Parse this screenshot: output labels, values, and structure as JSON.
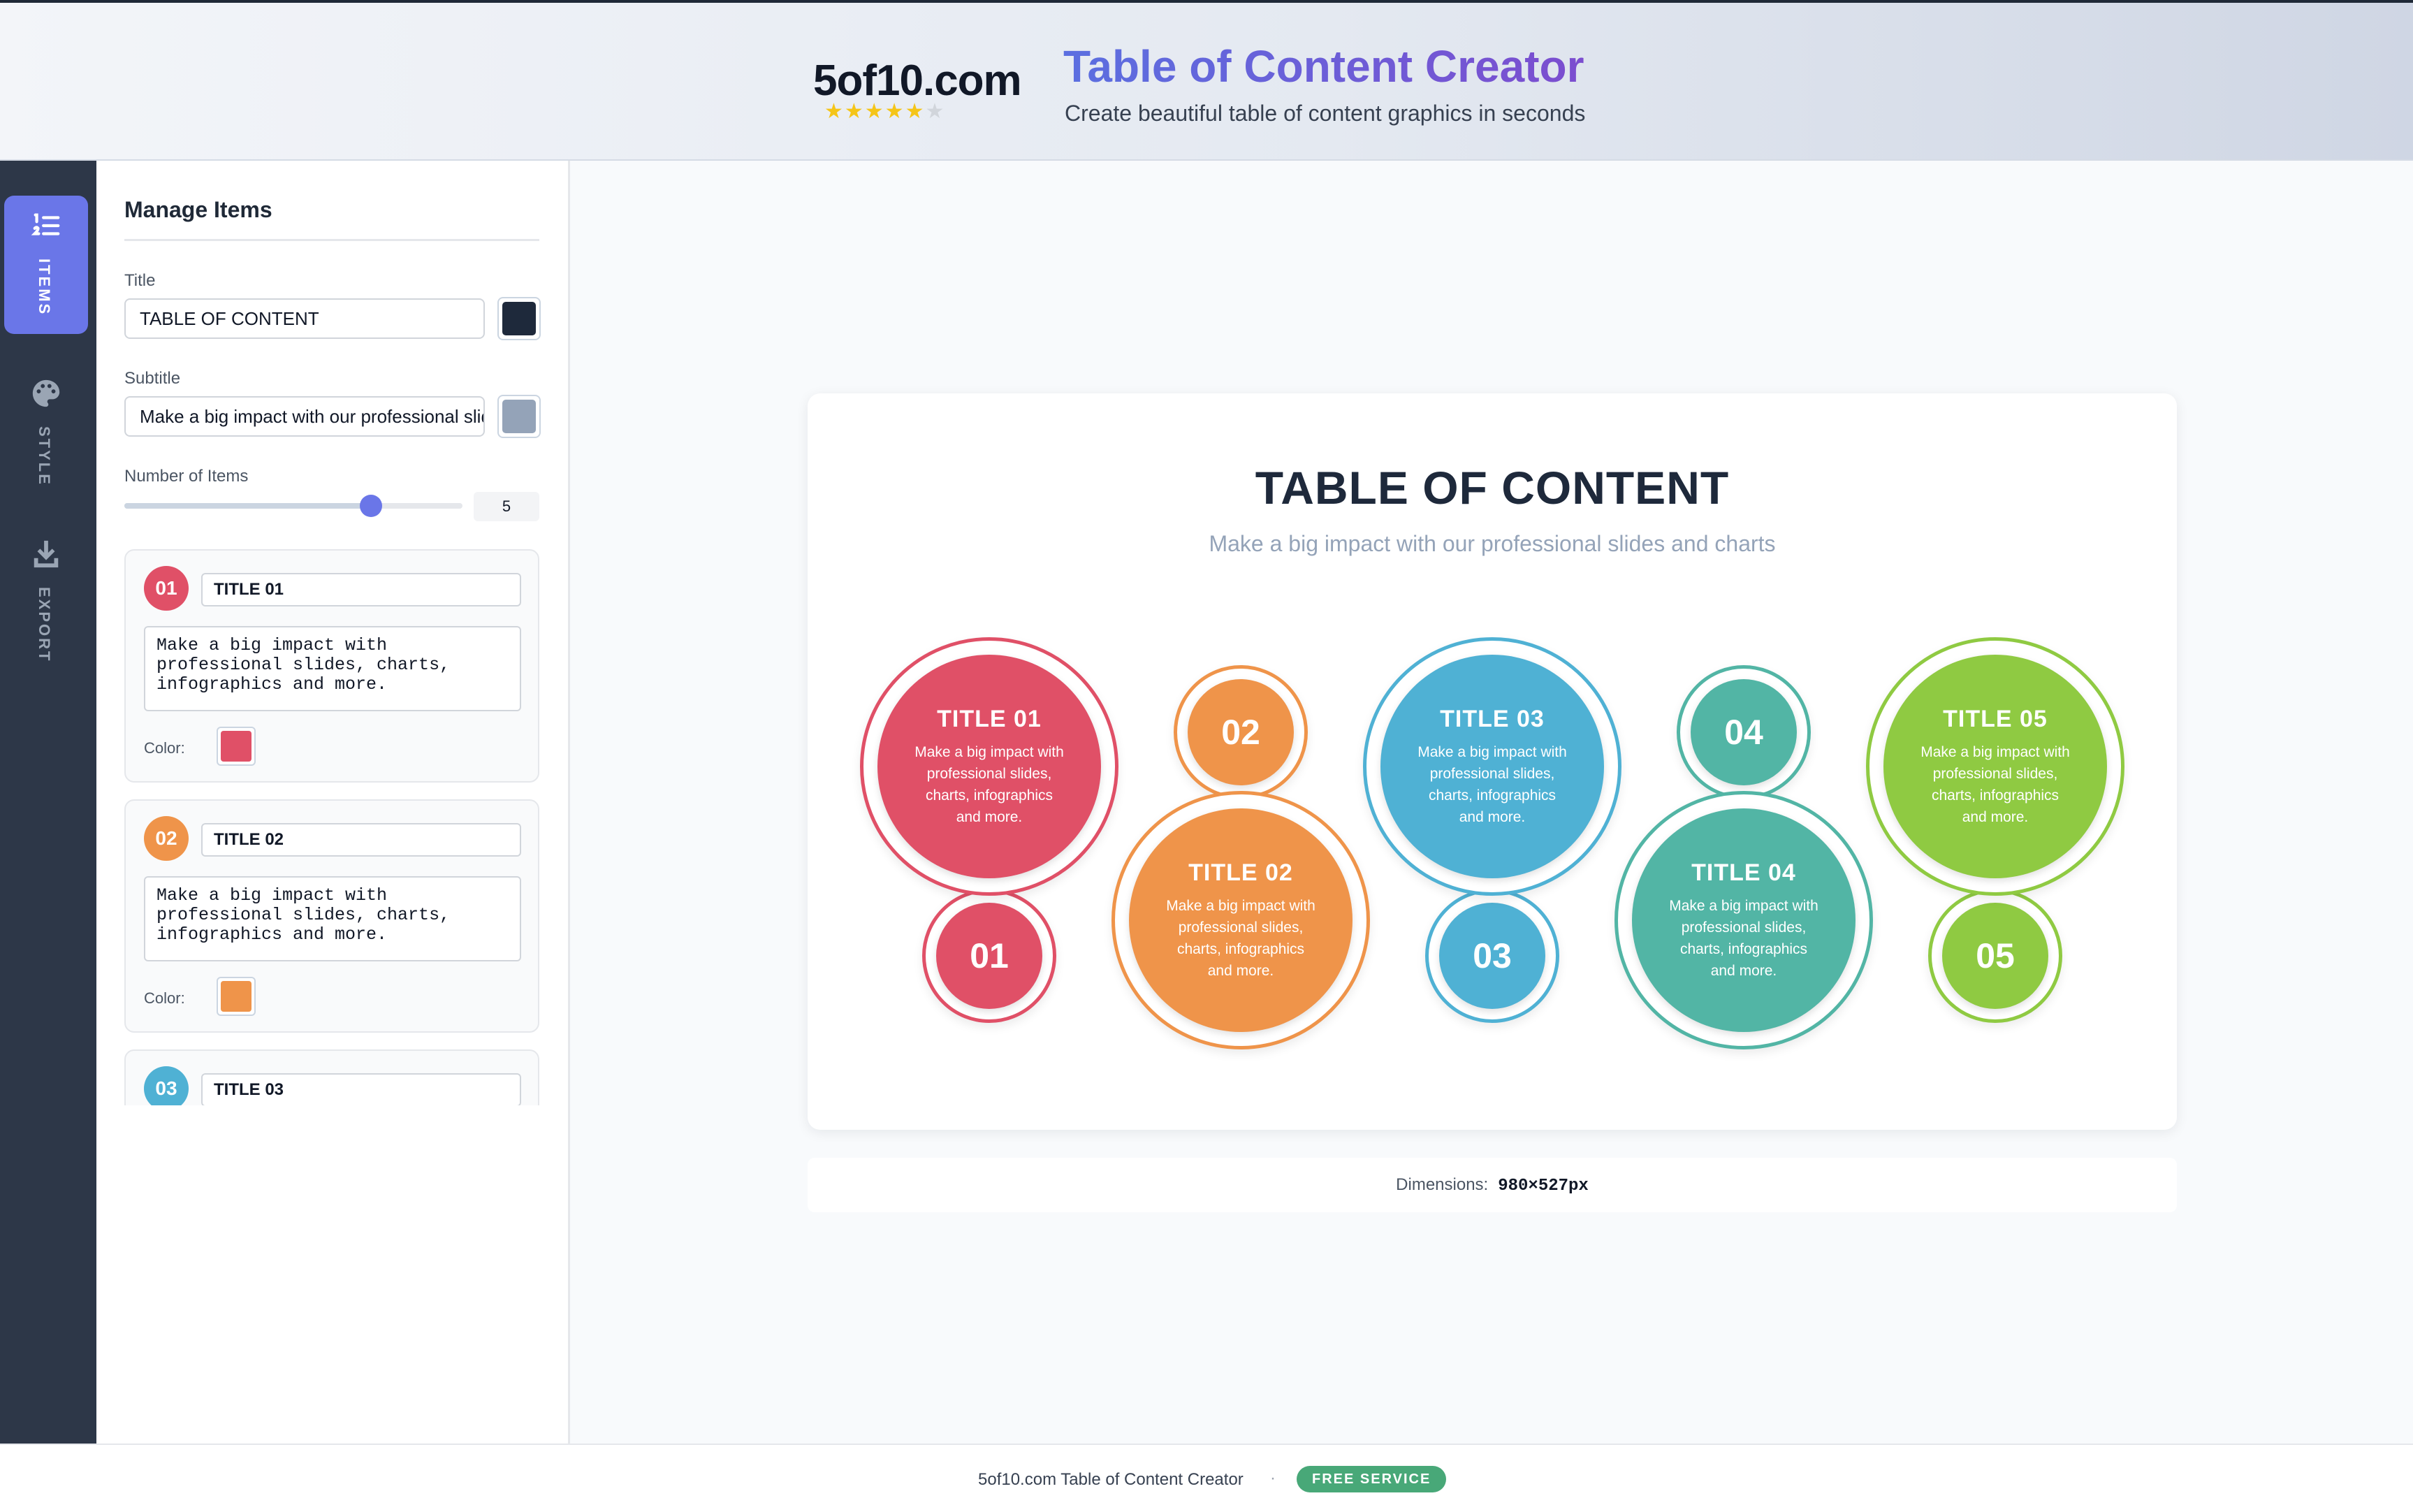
{
  "header": {
    "logo": "5of10.com",
    "stars_filled": "★★★★★",
    "stars_dim": "★",
    "title": "Table of Content Creator",
    "subtitle": "Create beautiful table of content graphics in seconds"
  },
  "nav": {
    "items": [
      {
        "label": "ITEMS",
        "icon": "list-ordered-icon",
        "active": true
      },
      {
        "label": "STYLE",
        "icon": "palette-icon",
        "active": false
      },
      {
        "label": "EXPORT",
        "icon": "download-icon",
        "active": false
      }
    ]
  },
  "sidebar": {
    "heading": "Manage Items",
    "title_label": "Title",
    "title_value": "TABLE OF CONTENT",
    "title_color": "#1e293b",
    "subtitle_label": "Subtitle",
    "subtitle_value": "Make a big impact with our professional slides and charts",
    "subtitle_color": "#94a3b8",
    "count_label": "Number of Items",
    "count_value": "5",
    "count_fraction": 0.73,
    "color_label": "Color:",
    "items": [
      {
        "num": "01",
        "title": "TITLE 01",
        "desc": "Make a big impact with\nprofessional slides, charts,\ninfographics and more.",
        "color": "#e05067"
      },
      {
        "num": "02",
        "title": "TITLE 02",
        "desc": "Make a big impact with\nprofessional slides, charts,\ninfographics and more.",
        "color": "#ef944a"
      },
      {
        "num": "03",
        "title": "TITLE 03",
        "desc": "Make a big impact with\nprofessional slides, charts,\ninfographics and more.",
        "color": "#4fb1d4"
      }
    ]
  },
  "preview": {
    "title": "TABLE OF CONTENT",
    "subtitle": "Make a big impact with our professional slides and charts",
    "items": [
      {
        "num": "01",
        "title": "TITLE 01",
        "desc": "Make a big impact with professional slides, charts, infographics and more.",
        "color": "#e05067"
      },
      {
        "num": "02",
        "title": "TITLE 02",
        "desc": "Make a big impact with professional slides, charts, infographics and more.",
        "color": "#ef944a"
      },
      {
        "num": "03",
        "title": "TITLE 03",
        "desc": "Make a big impact with professional slides, charts, infographics and more.",
        "color": "#4fb1d4"
      },
      {
        "num": "04",
        "title": "TITLE 04",
        "desc": "Make a big impact with professional slides, charts, infographics and more.",
        "color": "#52b5a5"
      },
      {
        "num": "05",
        "title": "TITLE 05",
        "desc": "Make a big impact with professional slides, charts, infographics and more.",
        "color": "#8fca42"
      }
    ],
    "dims_label": "Dimensions:",
    "dims_value": "980×527px"
  },
  "footer": {
    "text": "5of10.com Table of Content Creator",
    "dot": "·",
    "badge": "FREE SERVICE"
  }
}
